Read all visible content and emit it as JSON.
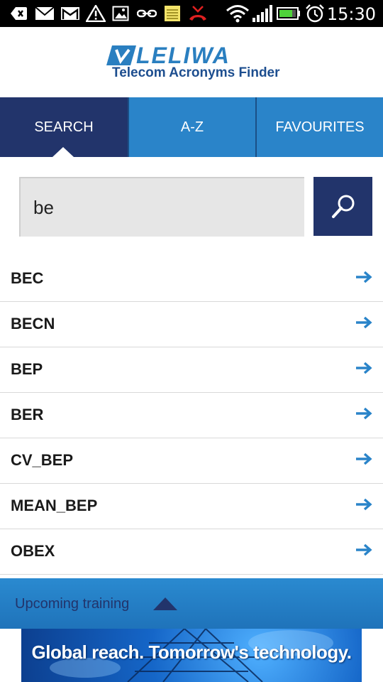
{
  "status_bar": {
    "time": "15:30",
    "icons": [
      "back-notification-icon",
      "email-icon",
      "gmail-icon",
      "warning-icon",
      "image-icon",
      "usb-link-icon",
      "notes-icon",
      "missed-call-icon",
      "wifi-icon",
      "signal-icon",
      "battery-icon",
      "alarm-icon"
    ]
  },
  "header": {
    "logo_word": "LELIWA",
    "logo_subtitle": "Telecom Acronyms Finder"
  },
  "tabs": [
    {
      "label": "SEARCH",
      "active": true
    },
    {
      "label": "A-Z",
      "active": false
    },
    {
      "label": "FAVOURITES",
      "active": false
    }
  ],
  "search": {
    "value": "be",
    "button_icon": "search-icon"
  },
  "results": [
    {
      "label": "BEC"
    },
    {
      "label": "BECN"
    },
    {
      "label": "BEP"
    },
    {
      "label": "BER"
    },
    {
      "label": "CV_BEP"
    },
    {
      "label": "MEAN_BEP"
    },
    {
      "label": "OBEX"
    }
  ],
  "training": {
    "label": "Upcoming training"
  },
  "banner": {
    "text": "Global reach. Tomorrow's technology."
  },
  "colors": {
    "navy": "#22346b",
    "blue": "#2a84c9",
    "arrow": "#2a84c9"
  }
}
